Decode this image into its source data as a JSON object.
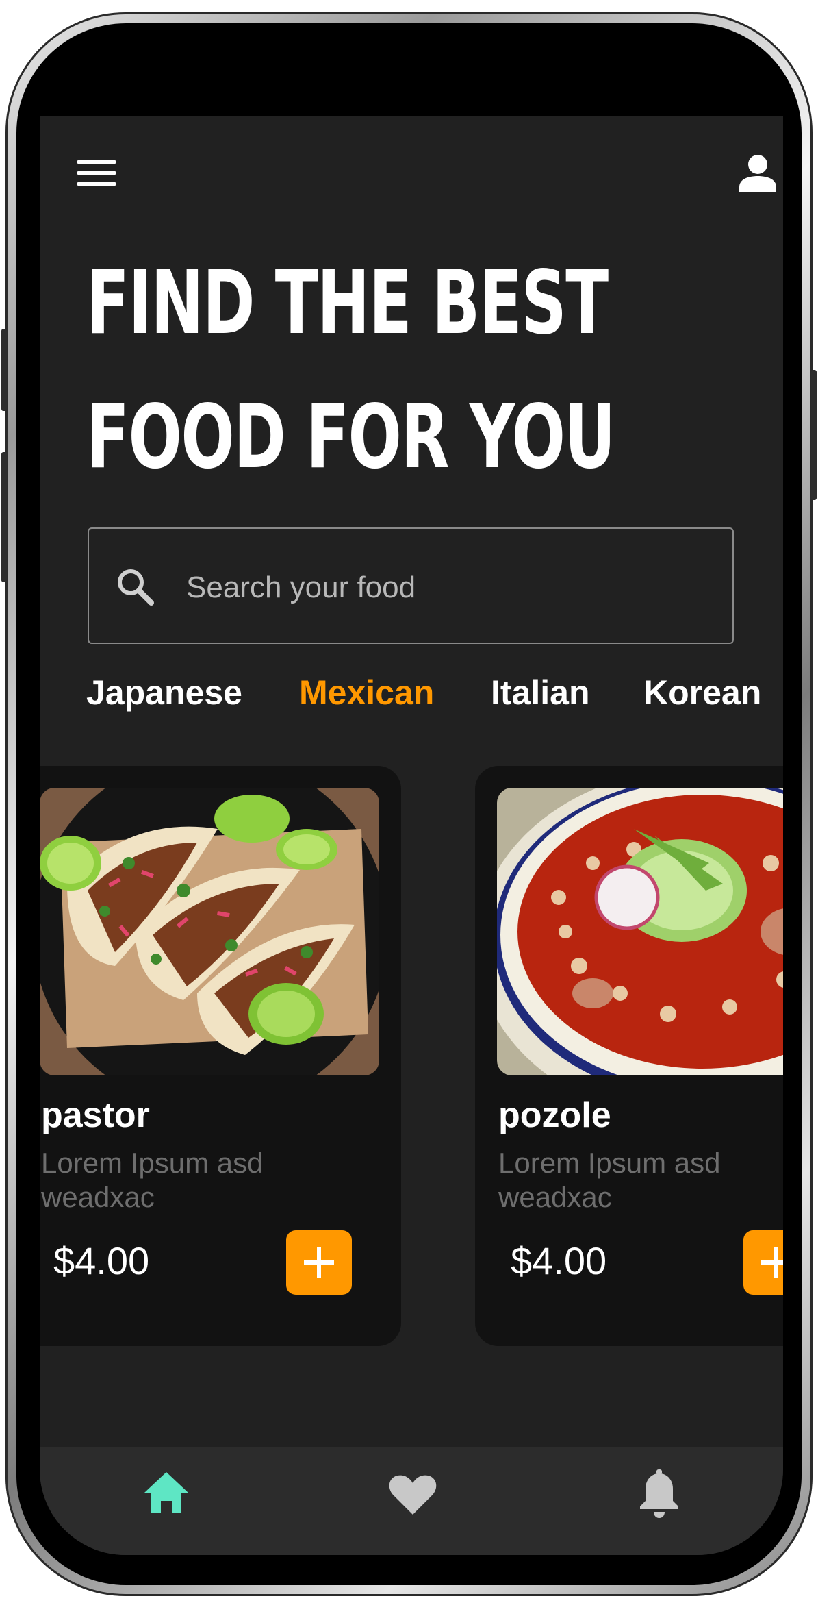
{
  "header": {
    "headline_line1": "FIND THE BEST",
    "headline_line2": "FOOD FOR YOU",
    "menu_icon": "hamburger-menu-icon",
    "profile_icon": "user-profile-icon"
  },
  "search": {
    "placeholder": "Search your food",
    "icon": "search-icon"
  },
  "categories": [
    {
      "label": "Japanese",
      "active": false
    },
    {
      "label": "Mexican",
      "active": true
    },
    {
      "label": "Italian",
      "active": false
    },
    {
      "label": "Korean",
      "active": false
    }
  ],
  "foods": [
    {
      "name": "pastor",
      "description": "Lorem Ipsum asd weadxac",
      "price": "$4.00",
      "image": "tacos-photo"
    },
    {
      "name": "pozole",
      "description": "Lorem Ipsum asd weadxac",
      "price": "$4.00",
      "image": "pozole-bowl-photo"
    }
  ],
  "bottom_nav": [
    {
      "icon": "home-icon",
      "active": true
    },
    {
      "icon": "heart-icon",
      "active": false
    },
    {
      "icon": "bell-icon",
      "active": false
    }
  ],
  "colors": {
    "background": "#212121",
    "card": "#121212",
    "accent": "#ff9800",
    "active_nav": "#5ee6c4",
    "inactive_nav": "#c8c8c8",
    "muted_text": "#6e6e6e"
  }
}
